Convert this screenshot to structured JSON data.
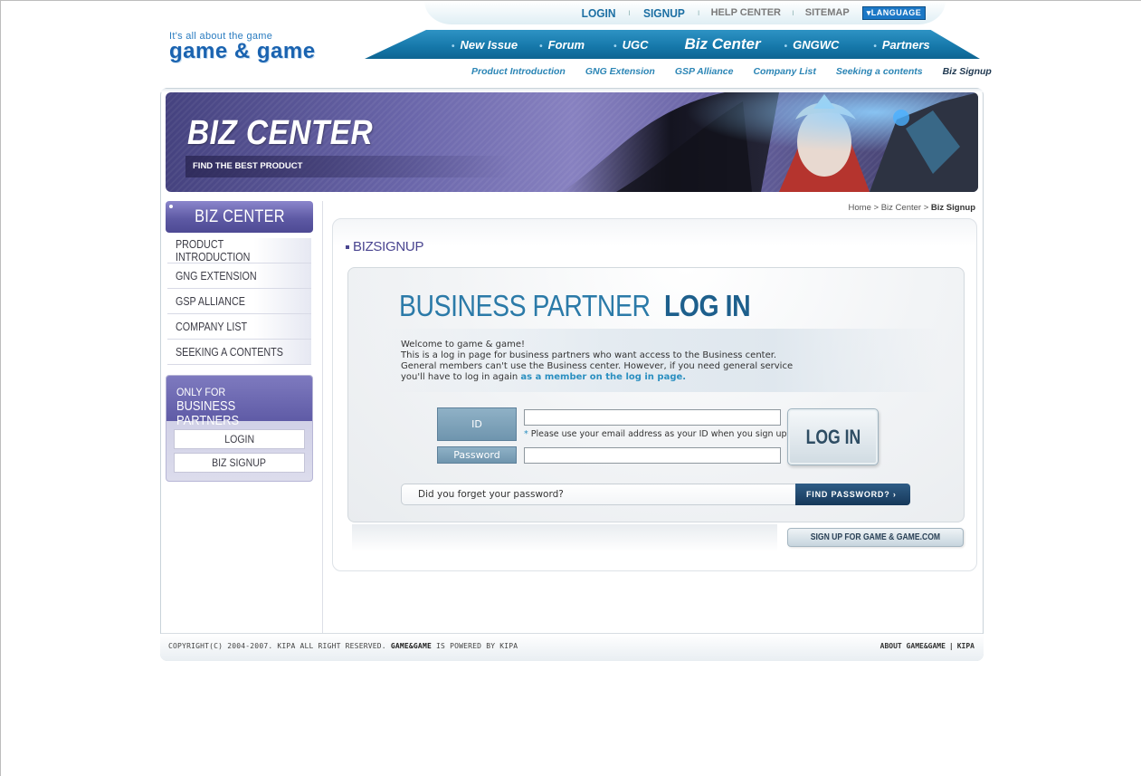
{
  "utility_nav": {
    "login": "LOGIN",
    "signup": "SIGNUP",
    "help_center": "HELP CENTER",
    "sitemap": "SITEMAP",
    "language": "▾LANGUAGE"
  },
  "logo": {
    "tagline": "It's all about the game",
    "name": "game & game"
  },
  "main_nav": {
    "items": [
      "New Issue",
      "Forum",
      "UGC",
      "Biz Center",
      "GNGWC",
      "Partners"
    ],
    "active": "Biz Center"
  },
  "sub_nav": {
    "items": [
      "Product Introduction",
      "GNG Extension",
      "GSP Alliance",
      "Company List",
      "Seeking a contents",
      "Biz Signup"
    ],
    "active": "Biz Signup"
  },
  "banner": {
    "title": "BIZ CENTER",
    "subtitle": "FIND THE BEST PRODUCT"
  },
  "sidebar": {
    "heading": "BIZ CENTER",
    "items": [
      "PRODUCT INTRODUCTION",
      "GNG EXTENSION",
      "GSP ALLIANCE",
      "COMPANY LIST",
      "SEEKING A CONTENTS"
    ],
    "partner_box": {
      "line1": "ONLY FOR",
      "line2": "BUSINESS PARTNERS",
      "login": "LOGIN",
      "signup": "BIZ SIGNUP"
    }
  },
  "breadcrumb": {
    "home": "Home",
    "sep1": ">",
    "section": "Biz Center",
    "sep2": ">",
    "current": "Biz Signup"
  },
  "main": {
    "section_title": "BIZSIGNUP",
    "heading_thin": "BUSINESS PARTNER",
    "heading_bold": "LOG IN",
    "intro": {
      "line1": "Welcome to game & game!",
      "line2": "This is a log in page for business partners who want access to the Business center.",
      "line3": "General members can't use the Business center. However, if you need general service",
      "line4_prefix": "you'll have to log in again",
      "line4_link": "as a member on the log in page."
    },
    "form": {
      "id_label": "ID",
      "password_label": "Password",
      "id_value": "",
      "password_value": "",
      "id_note_star": "*",
      "id_note": "Please use your email address as your ID when you sign up.",
      "login_button": "LOG IN"
    },
    "forgot": {
      "text": "Did you forget your password?",
      "button": "FIND PASSWORD? ›"
    },
    "signup_button": "SIGN UP FOR GAME & GAME.COM"
  },
  "footer": {
    "copyright_prefix": "COPYRIGHT(C) 2004-2007. KIPA ALL RIGHT RESERVED.",
    "brand": "GAME&GAME",
    "copyright_suffix": "IS POWERED BY KIPA",
    "about": "ABOUT GAME&GAME",
    "sep": "|",
    "kipa": "KIPA"
  },
  "colors": {
    "nav_blue": "#1577a9",
    "purple": "#5e5aa4",
    "link_blue": "#2a8fc0",
    "dark_button": "#16385a"
  }
}
